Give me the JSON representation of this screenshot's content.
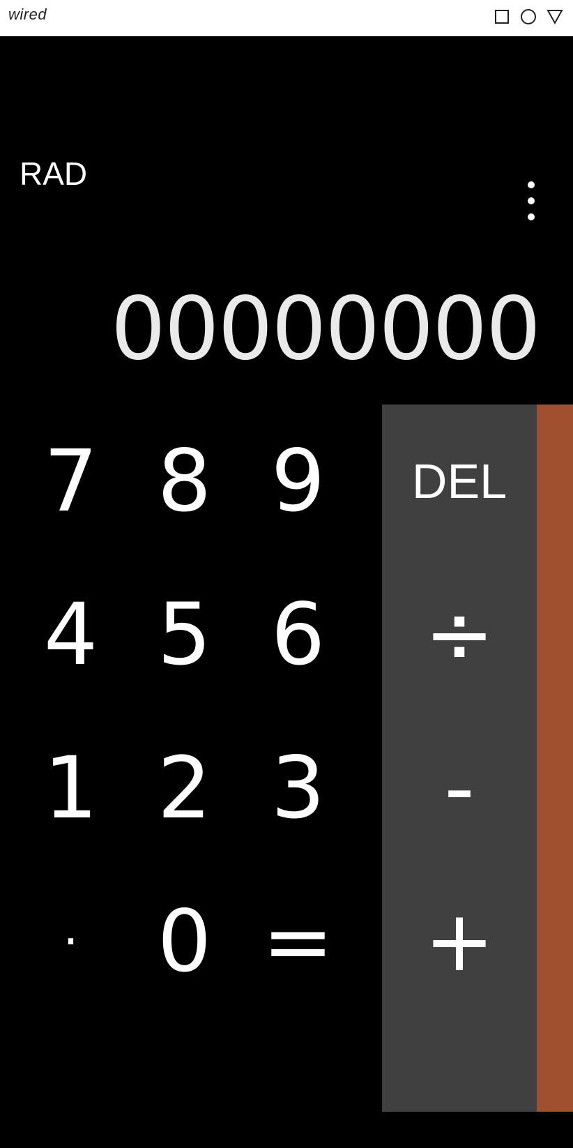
{
  "status_bar": {
    "brand": "wired",
    "icons": [
      "square-icon",
      "circle-icon",
      "triangle-icon"
    ]
  },
  "calculator": {
    "mode": "RAD",
    "display": "00000000",
    "digits": [
      "7",
      "8",
      "9",
      "4",
      "5",
      "6",
      "1",
      "2",
      "3",
      "·",
      "0",
      "="
    ],
    "ops": [
      "DEL",
      "÷",
      "-",
      "+"
    ],
    "colors": {
      "background": "#000000",
      "ops_panel": "#404040",
      "advanced_panel": "#a0502f",
      "text": "#ffffff"
    }
  }
}
